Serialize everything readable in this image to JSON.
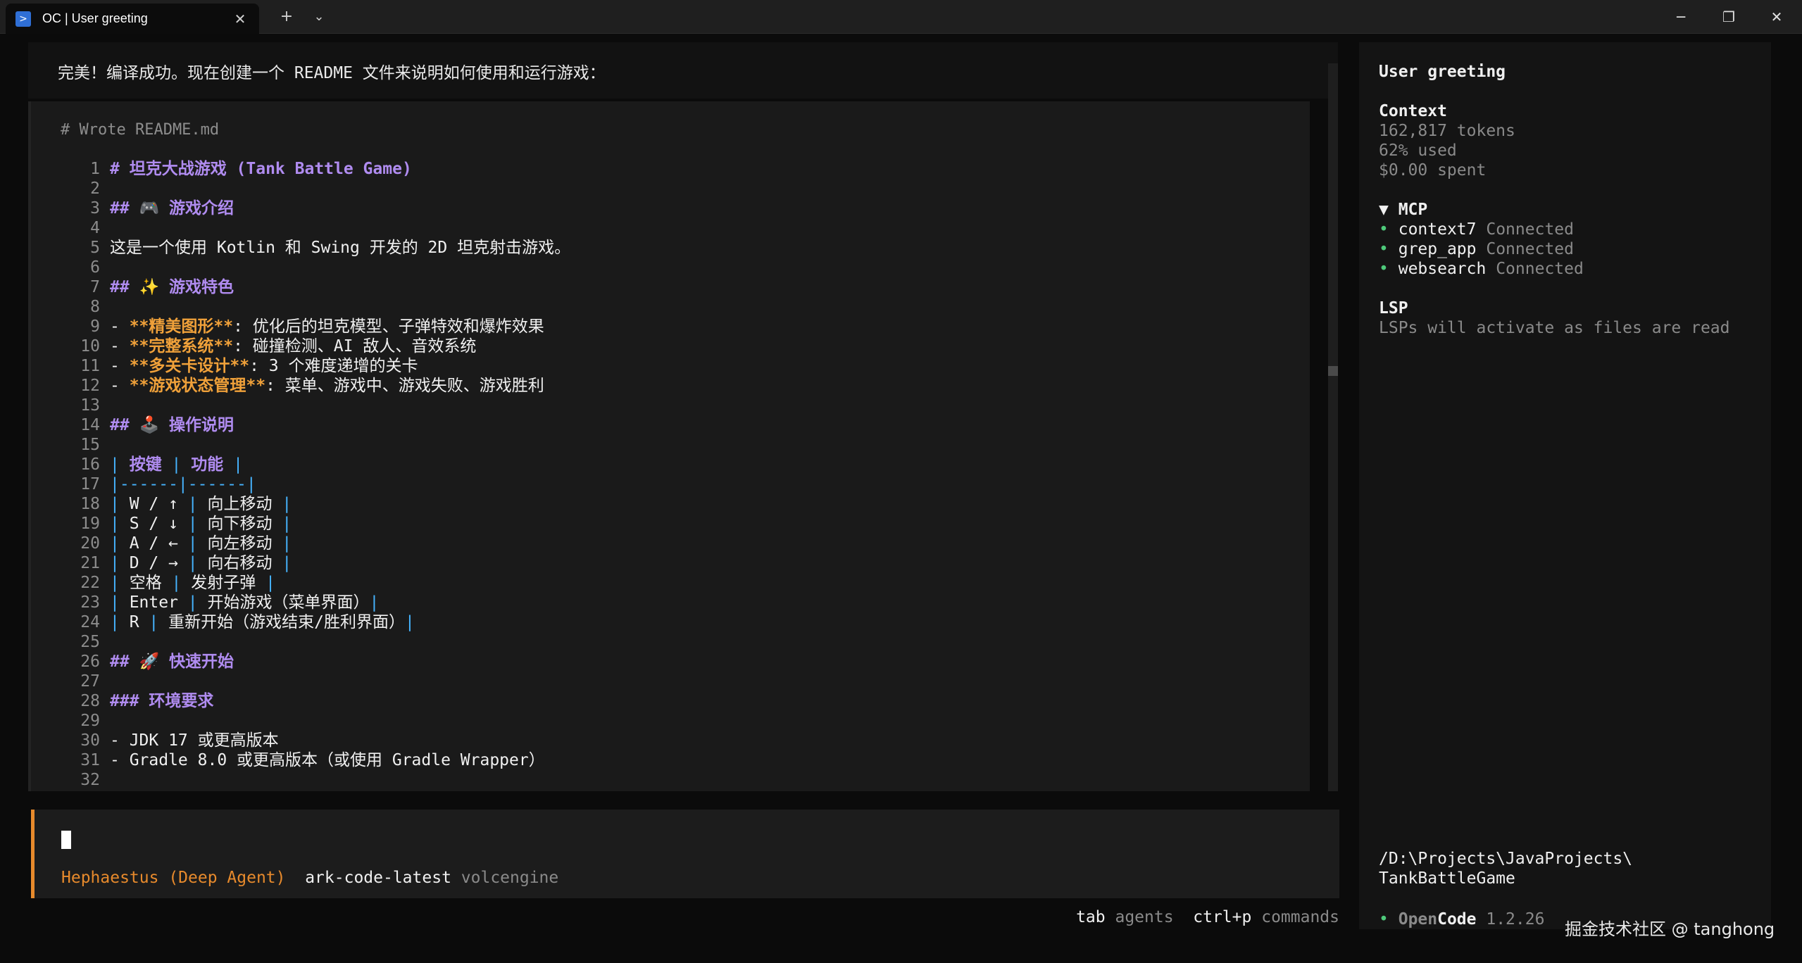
{
  "window": {
    "tab_title": "OC | User greeting",
    "tab_icon": "powershell-icon",
    "new_tab_glyph": "+",
    "dropdown_glyph": "⌄",
    "minimize_glyph": "─",
    "restore_glyph": "❐",
    "close_glyph": "✕",
    "tab_close_glyph": "✕"
  },
  "chat": {
    "message": "完美！编译成功。现在创建一个 README 文件来说明如何使用和运行游戏：",
    "tool_header": "# Wrote README.md",
    "lines": [
      {
        "n": "1",
        "segs": [
          {
            "c": "h",
            "t": "# 坦克大战游戏 (Tank Battle Game)"
          }
        ]
      },
      {
        "n": "2",
        "segs": []
      },
      {
        "n": "3",
        "segs": [
          {
            "c": "h",
            "t": "## 🎮 游戏介绍"
          }
        ]
      },
      {
        "n": "4",
        "segs": []
      },
      {
        "n": "5",
        "segs": [
          {
            "c": "n",
            "t": "这是一个使用 Kotlin 和 Swing 开发的 2D 坦克射击游戏。"
          }
        ]
      },
      {
        "n": "6",
        "segs": []
      },
      {
        "n": "7",
        "segs": [
          {
            "c": "h",
            "t": "## ✨ 游戏特色"
          }
        ]
      },
      {
        "n": "8",
        "segs": []
      },
      {
        "n": "9",
        "segs": [
          {
            "c": "n",
            "t": "- "
          },
          {
            "c": "b",
            "t": "**精美图形**"
          },
          {
            "c": "n",
            "t": ": 优化后的坦克模型、子弹特效和爆炸效果"
          }
        ]
      },
      {
        "n": "10",
        "segs": [
          {
            "c": "n",
            "t": "- "
          },
          {
            "c": "b",
            "t": "**完整系统**"
          },
          {
            "c": "n",
            "t": ": 碰撞检测、AI 敌人、音效系统"
          }
        ]
      },
      {
        "n": "11",
        "segs": [
          {
            "c": "n",
            "t": "- "
          },
          {
            "c": "b",
            "t": "**多关卡设计**"
          },
          {
            "c": "n",
            "t": ": 3 个难度递增的关卡"
          }
        ]
      },
      {
        "n": "12",
        "segs": [
          {
            "c": "n",
            "t": "- "
          },
          {
            "c": "b",
            "t": "**游戏状态管理**"
          },
          {
            "c": "n",
            "t": ": 菜单、游戏中、游戏失败、游戏胜利"
          }
        ]
      },
      {
        "n": "13",
        "segs": []
      },
      {
        "n": "14",
        "segs": [
          {
            "c": "h",
            "t": "## 🕹️ 操作说明"
          }
        ]
      },
      {
        "n": "15",
        "segs": []
      },
      {
        "n": "16",
        "segs": [
          {
            "c": "t",
            "t": "| "
          },
          {
            "c": "th",
            "t": "按键"
          },
          {
            "c": "t",
            "t": " | "
          },
          {
            "c": "th",
            "t": "功能"
          },
          {
            "c": "t",
            "t": " |"
          }
        ]
      },
      {
        "n": "17",
        "segs": [
          {
            "c": "t",
            "t": "|------|------|"
          }
        ]
      },
      {
        "n": "18",
        "segs": [
          {
            "c": "t",
            "t": "| "
          },
          {
            "c": "n",
            "t": "W / ↑"
          },
          {
            "c": "t",
            "t": " | "
          },
          {
            "c": "n",
            "t": "向上移动"
          },
          {
            "c": "t",
            "t": " |"
          }
        ]
      },
      {
        "n": "19",
        "segs": [
          {
            "c": "t",
            "t": "| "
          },
          {
            "c": "n",
            "t": "S / ↓"
          },
          {
            "c": "t",
            "t": " | "
          },
          {
            "c": "n",
            "t": "向下移动"
          },
          {
            "c": "t",
            "t": " |"
          }
        ]
      },
      {
        "n": "20",
        "segs": [
          {
            "c": "t",
            "t": "| "
          },
          {
            "c": "n",
            "t": "A / ←"
          },
          {
            "c": "t",
            "t": " | "
          },
          {
            "c": "n",
            "t": "向左移动"
          },
          {
            "c": "t",
            "t": " |"
          }
        ]
      },
      {
        "n": "21",
        "segs": [
          {
            "c": "t",
            "t": "| "
          },
          {
            "c": "n",
            "t": "D / →"
          },
          {
            "c": "t",
            "t": " | "
          },
          {
            "c": "n",
            "t": "向右移动"
          },
          {
            "c": "t",
            "t": " |"
          }
        ]
      },
      {
        "n": "22",
        "segs": [
          {
            "c": "t",
            "t": "| "
          },
          {
            "c": "n",
            "t": "空格"
          },
          {
            "c": "t",
            "t": " | "
          },
          {
            "c": "n",
            "t": "发射子弹"
          },
          {
            "c": "t",
            "t": " |"
          }
        ]
      },
      {
        "n": "23",
        "segs": [
          {
            "c": "t",
            "t": "| "
          },
          {
            "c": "n",
            "t": "Enter"
          },
          {
            "c": "t",
            "t": " | "
          },
          {
            "c": "n",
            "t": "开始游戏（菜单界面）"
          },
          {
            "c": "t",
            "t": "|"
          }
        ]
      },
      {
        "n": "24",
        "segs": [
          {
            "c": "t",
            "t": "| "
          },
          {
            "c": "n",
            "t": "R"
          },
          {
            "c": "t",
            "t": " | "
          },
          {
            "c": "n",
            "t": "重新开始（游戏结束/胜利界面）"
          },
          {
            "c": "t",
            "t": "|"
          }
        ]
      },
      {
        "n": "25",
        "segs": []
      },
      {
        "n": "26",
        "segs": [
          {
            "c": "h",
            "t": "## 🚀 快速开始"
          }
        ]
      },
      {
        "n": "27",
        "segs": []
      },
      {
        "n": "28",
        "segs": [
          {
            "c": "h",
            "t": "### 环境要求"
          }
        ]
      },
      {
        "n": "29",
        "segs": []
      },
      {
        "n": "30",
        "segs": [
          {
            "c": "n",
            "t": "- JDK 17 或更高版本"
          }
        ]
      },
      {
        "n": "31",
        "segs": [
          {
            "c": "n",
            "t": "- Gradle 8.0 或更高版本（或使用 Gradle Wrapper）"
          }
        ]
      },
      {
        "n": "32",
        "segs": []
      }
    ]
  },
  "prompt": {
    "agent": "Hephaestus (Deep Agent)",
    "model": "ark-code-latest",
    "provider": "volcengine"
  },
  "hints": {
    "tab_key": "tab",
    "tab_label": "agents",
    "cmd_key": "ctrl+p",
    "cmd_label": "commands"
  },
  "sidebar": {
    "title": "User greeting",
    "context_title": "Context",
    "tokens": "162,817 tokens",
    "used": "62% used",
    "spent": "$0.00 spent",
    "mcp_title": "▼ MCP",
    "mcp": [
      {
        "name": "context7",
        "status": "Connected"
      },
      {
        "name": "grep_app",
        "status": "Connected"
      },
      {
        "name": "websearch",
        "status": "Connected"
      }
    ],
    "lsp_title": "LSP",
    "lsp_text": "LSPs will activate as files are read",
    "path_line1": "/D:\\Projects\\JavaProjects\\",
    "path_line2": "TankBattleGame",
    "app_name_a": "Open",
    "app_name_b": "Code",
    "version": "1.2.26",
    "dot": "•"
  },
  "watermark": "掘金技术社区 @ tanghong",
  "colors": {
    "accent_orange": "#e78a2c",
    "heading_purple": "#b08cf0",
    "table_blue": "#46b4ff",
    "connected_green": "#4ec97a"
  }
}
